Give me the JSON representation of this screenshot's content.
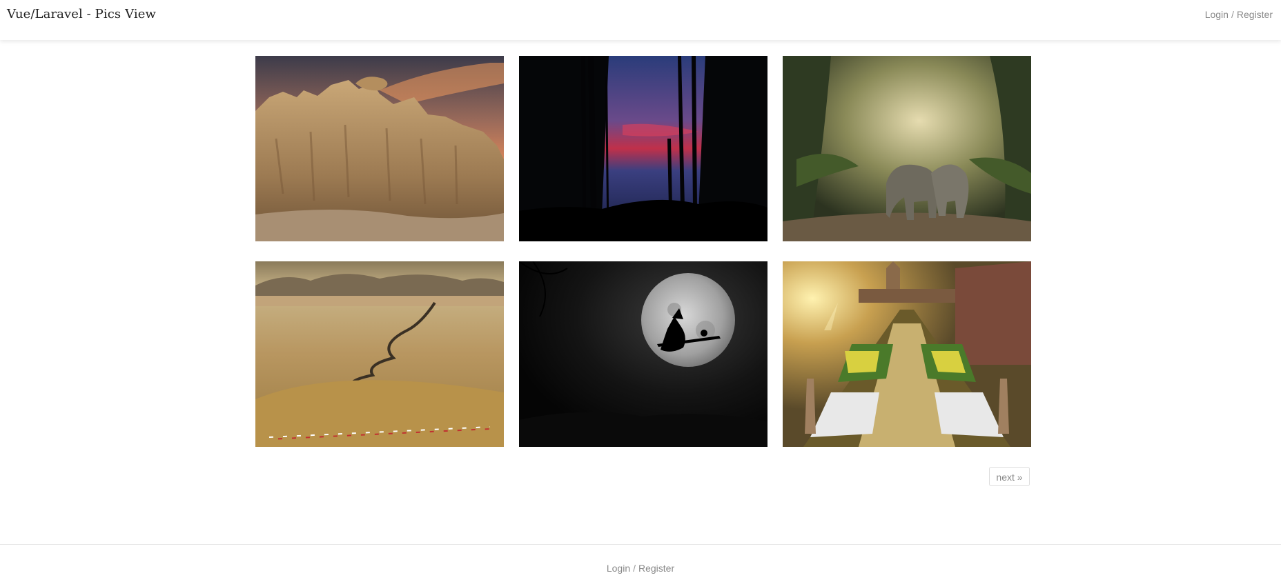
{
  "header": {
    "brand": "Vue/Laravel - Pics View",
    "login_label": "Login",
    "separator": "/",
    "register_label": "Register"
  },
  "gallery": {
    "images": [
      {
        "name": "Sandstone rock formation at sunset"
      },
      {
        "name": "Dark forest silhouette with red clouds"
      },
      {
        "name": "Elephants in misty jungle"
      },
      {
        "name": "Winding road through desert valley"
      },
      {
        "name": "Witch flying across full moon"
      },
      {
        "name": "Castle garden with flower beds"
      }
    ]
  },
  "pagination": {
    "next_label": "next »"
  },
  "footer": {
    "login_label": "Login",
    "separator": "/",
    "register_label": "Register"
  },
  "colors": {
    "text_muted": "#888888",
    "brand": "#222222",
    "border": "#dddddd"
  }
}
